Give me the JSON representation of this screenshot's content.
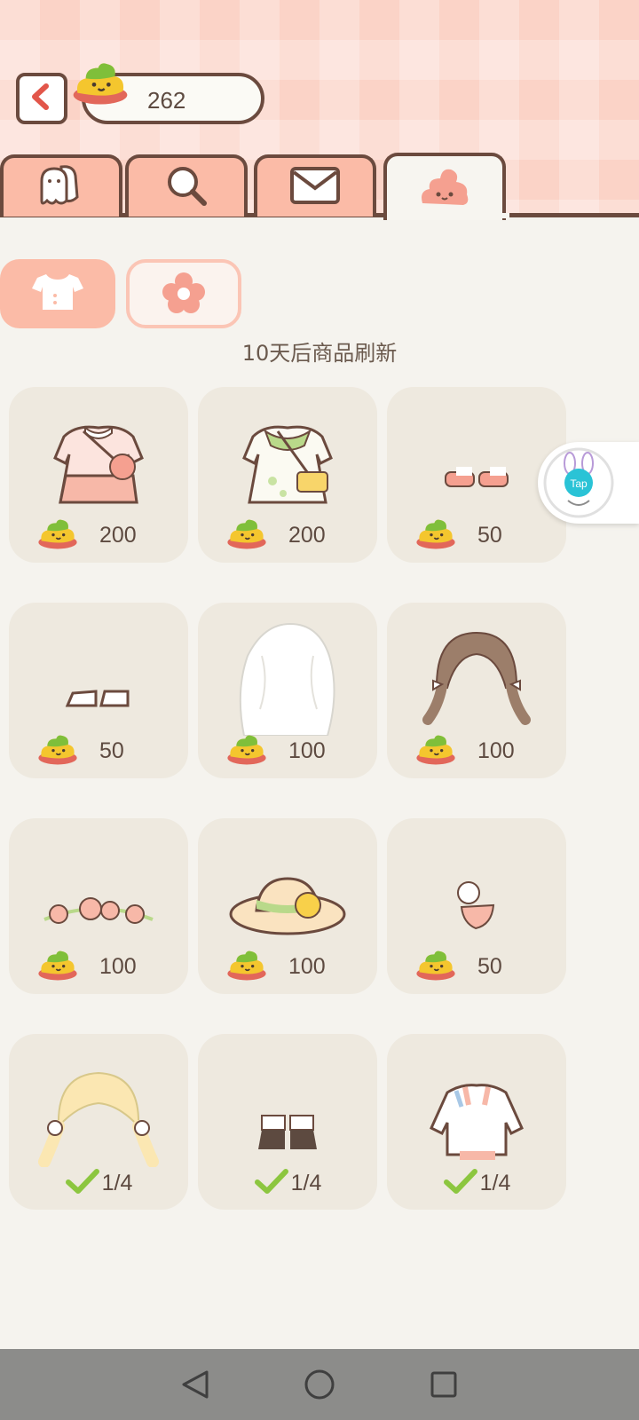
{
  "header": {
    "coin_count": "262"
  },
  "tabs": [
    {
      "name": "friends",
      "icon": "friends-icon"
    },
    {
      "name": "search",
      "icon": "search-icon"
    },
    {
      "name": "mail",
      "icon": "mail-icon"
    },
    {
      "name": "shop",
      "icon": "poop-icon",
      "active": true
    }
  ],
  "categories": [
    {
      "name": "clothes",
      "icon": "shirt-icon",
      "selected": true
    },
    {
      "name": "decor",
      "icon": "flower-icon",
      "selected": false
    }
  ],
  "refresh_note": "10天后商品刷新",
  "items": [
    {
      "kind": "pink-dress",
      "price": "200"
    },
    {
      "kind": "green-dress",
      "price": "200"
    },
    {
      "kind": "pink-shoes",
      "price": "50"
    },
    {
      "kind": "white-shoes",
      "price": "50"
    },
    {
      "kind": "white-hair",
      "price": "100"
    },
    {
      "kind": "brown-braids",
      "price": "100"
    },
    {
      "kind": "flower-crown",
      "price": "100"
    },
    {
      "kind": "straw-hat",
      "price": "100"
    },
    {
      "kind": "strawberry-clip",
      "price": "50"
    },
    {
      "kind": "blonde-pigtails",
      "owned": "1/4"
    },
    {
      "kind": "brown-boots",
      "owned": "1/4"
    },
    {
      "kind": "white-jacket",
      "owned": "1/4"
    }
  ],
  "tap_badge": "Tap",
  "colors": {
    "header_pink": "#fbd3c7",
    "tab_pink": "#fbbba7",
    "outline_brown": "#6b4a3e",
    "card_bg": "#eee9df",
    "check_green": "#8cc63f"
  }
}
